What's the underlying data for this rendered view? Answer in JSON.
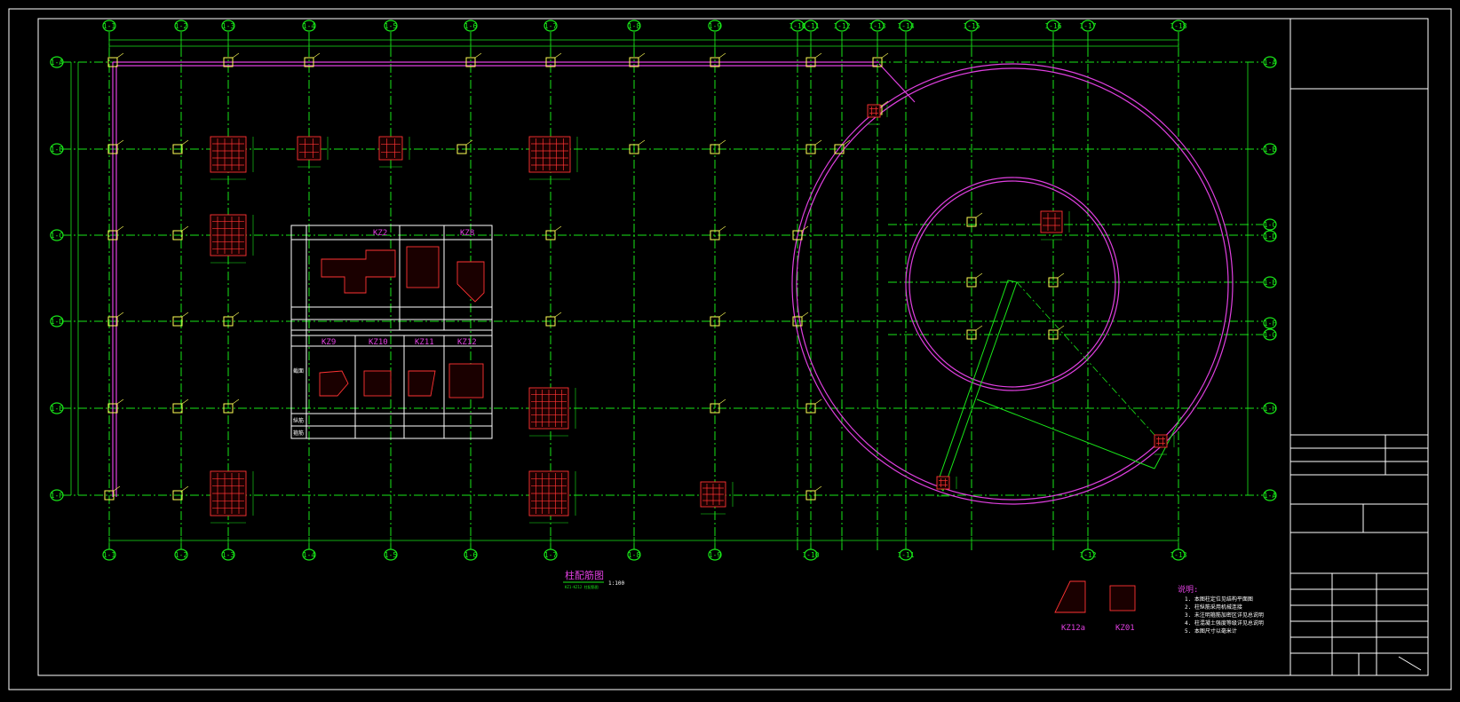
{
  "colors": {
    "background": "#000000",
    "grid": "#19e619",
    "column": "#ffff55",
    "wall": "#e040e0",
    "rebar": "#ff3333",
    "frame": "#ffffff"
  },
  "drawing": {
    "title": "柱配筋图",
    "scale": "1:100",
    "title_underline": "KZ1-KZ12 柱配筋图"
  },
  "axes": {
    "top": [
      "1-1",
      "1-2",
      "1-3",
      "1-4",
      "1-5",
      "1-6",
      "1-7",
      "1-8",
      "1-9",
      "1-10",
      "1-11",
      "1-12",
      "1-13",
      "1-14",
      "1-15",
      "1-16",
      "1-17",
      "1-18"
    ],
    "bottom": [
      "1-1",
      "1-2",
      "1-3",
      "1-4",
      "1-5",
      "1-6",
      "1-7",
      "1-8",
      "1-9",
      "1-10",
      "1-11",
      "1-12",
      "1-13"
    ],
    "left": [
      "1-A",
      "1-B",
      "1-C",
      "1-D",
      "1-E",
      "1-F"
    ],
    "right": [
      "1-A",
      "1-B",
      "1-C",
      "1-D",
      "1-E",
      "1-F",
      "1-G",
      "1-H"
    ]
  },
  "schedule_table": {
    "headers": [
      "KZ2",
      "KZ8",
      "KZ9",
      "KZ10",
      "KZ11",
      "KZ12"
    ],
    "rows": [
      "截面",
      "纵筋",
      "箍筋"
    ]
  },
  "details": [
    {
      "label": "KZ12a"
    },
    {
      "label": "KZ01"
    }
  ],
  "notes": {
    "heading": "说明:",
    "items": [
      "1. 本图柱定位见结构平面图",
      "2. 柱纵筋采用机械连接",
      "3. 未注明箍筋加密区详见总说明",
      "4. 柱混凝土强度等级详见总说明",
      "5. 本图尺寸以毫米计"
    ]
  }
}
